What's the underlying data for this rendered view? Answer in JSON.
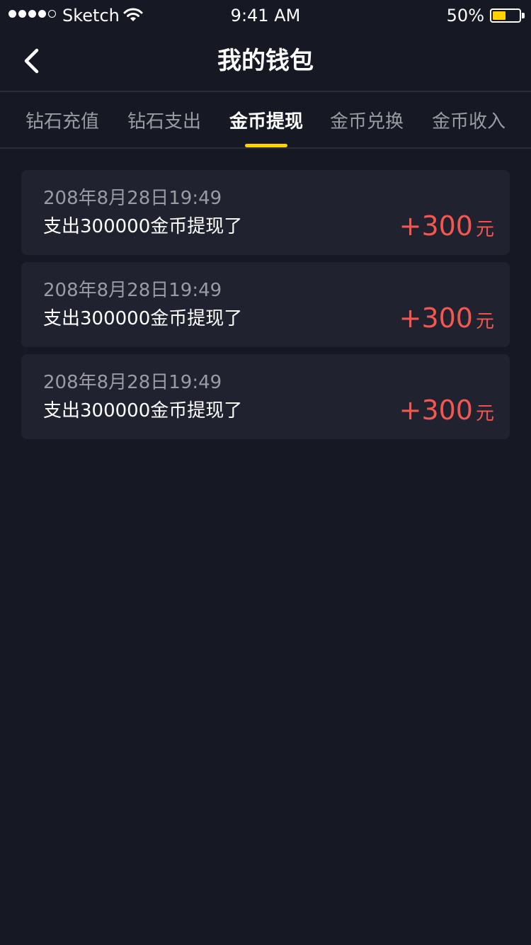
{
  "status_bar": {
    "carrier": "Sketch",
    "time": "9:41 AM",
    "battery_percent": "50%",
    "battery_level": 0.5,
    "signal_bars_filled": 4,
    "signal_bars_total": 5
  },
  "nav": {
    "title": "我的钱包",
    "back_icon": "chevron-left-icon"
  },
  "tabs": [
    {
      "label": "钻石充值",
      "active": false
    },
    {
      "label": "钻石支出",
      "active": false
    },
    {
      "label": "金币提现",
      "active": true
    },
    {
      "label": "金币兑换",
      "active": false
    },
    {
      "label": "金币收入",
      "active": false
    }
  ],
  "records": [
    {
      "time": "208年8月28日19:49",
      "description": "支出300000金币提现了",
      "amount": "+300",
      "unit": "元"
    },
    {
      "time": "208年8月28日19:49",
      "description": "支出300000金币提现了",
      "amount": "+300",
      "unit": "元"
    },
    {
      "time": "208年8月28日19:49",
      "description": "支出300000金币提现了",
      "amount": "+300",
      "unit": "元"
    }
  ],
  "colors": {
    "background": "#161823",
    "card": "#202230",
    "accent": "#ffd200",
    "amount": "#f4574f",
    "muted_text": "#9a9ba3"
  }
}
